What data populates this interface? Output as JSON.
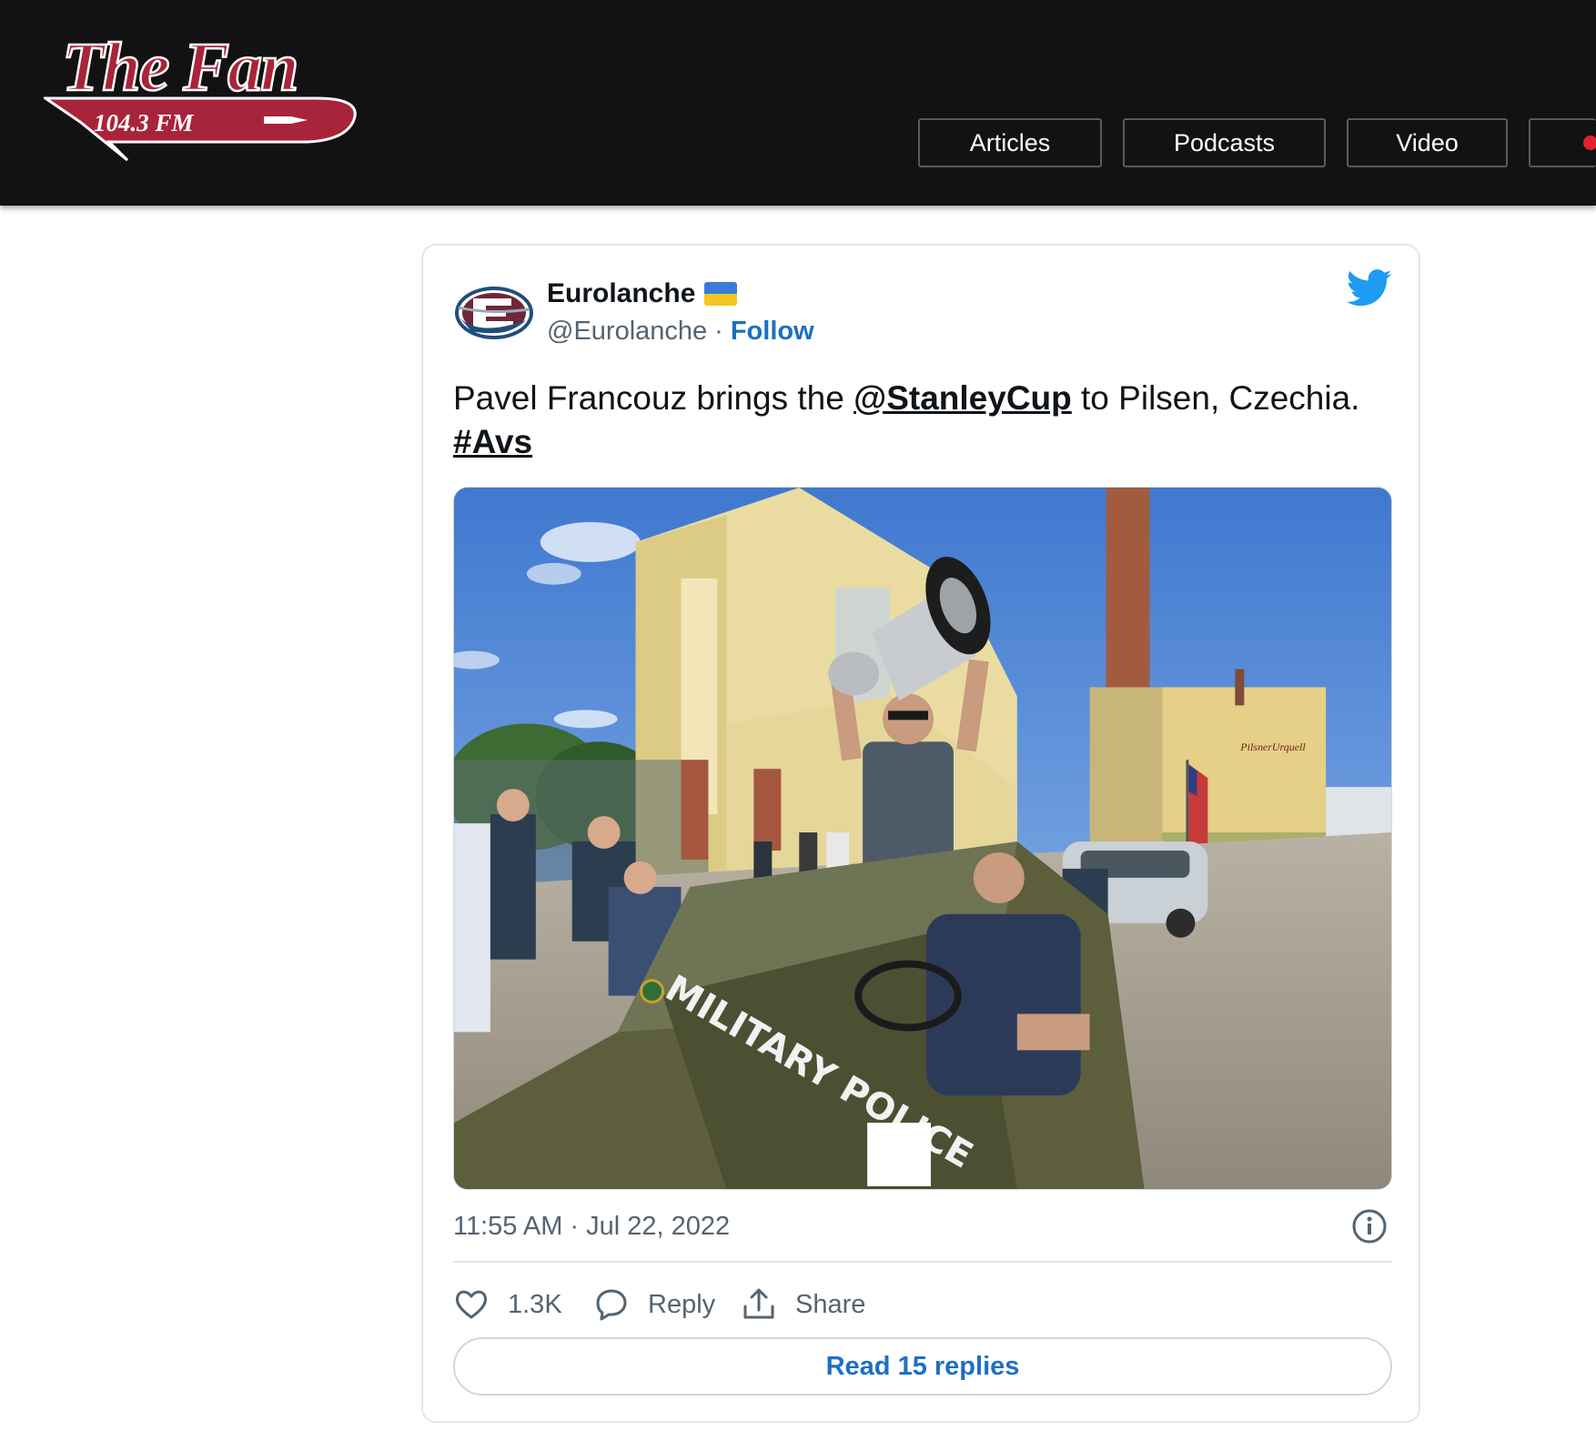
{
  "header": {
    "logo_text": "The Fan",
    "logo_frequency": "104.3 FM",
    "nav": [
      {
        "label": "Articles"
      },
      {
        "label": "Podcasts"
      },
      {
        "label": "Video"
      },
      {
        "label": ""
      }
    ],
    "colors": {
      "background": "#121212",
      "logo_red": "#a8243a",
      "live_dot": "#e3222b"
    }
  },
  "tweet": {
    "author": {
      "name": "Eurolanche",
      "handle": "@Eurolanche",
      "separator": "·",
      "follow_label": "Follow",
      "flag_icon": "ukraine-flag-icon"
    },
    "text": {
      "part1": "Pavel Francouz brings the ",
      "mention": "@StanleyCup",
      "part2": " to Pilsen, Czechia. ",
      "hashtag": "#Avs"
    },
    "media": {
      "vehicle_text": "MILITARY POLICE",
      "sign_text": "PilsnerUrquell"
    },
    "timestamp": "11:55 AM · Jul 22, 2022",
    "actions": {
      "like_count": "1.3K",
      "reply_label": "Reply",
      "share_label": "Share"
    },
    "read_replies_label": "Read 15 replies",
    "colors": {
      "link_blue": "#1d6fc4",
      "twitter_blue": "#1d9bf0",
      "text": "#0f1419",
      "muted": "#536471"
    }
  }
}
